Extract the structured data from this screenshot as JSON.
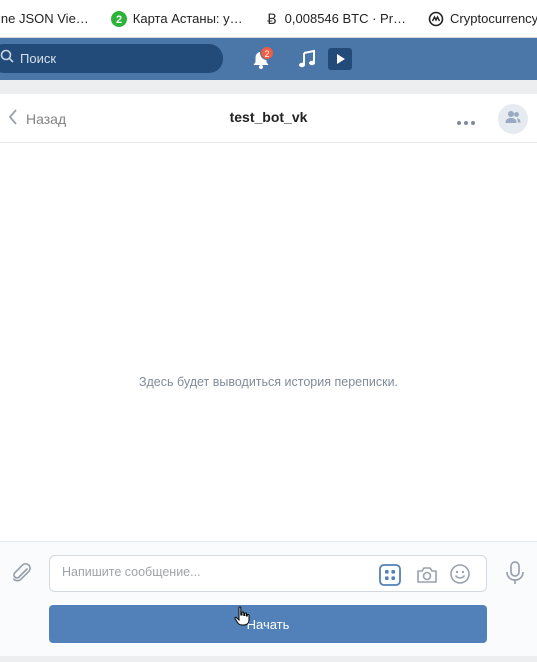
{
  "bookmarks": [
    {
      "label": "ine JSON Vie…",
      "icon": "json-viewer-icon"
    },
    {
      "label": "Карта Астаны: у…",
      "icon": "2gis-icon"
    },
    {
      "label": "0,008546 BTC · Pr…",
      "icon": "bitcoin-icon"
    },
    {
      "label": "Cryptocurrency…",
      "icon": "coinmarketcap-icon"
    }
  ],
  "topbar": {
    "search_placeholder": "Поиск",
    "notification_count": "2",
    "accent": "#4a76a8"
  },
  "chat": {
    "back_label": "Назад",
    "title": "test_bot_vk",
    "empty_text": "Здесь будет выводиться история переписки."
  },
  "composer": {
    "placeholder": "Напишите сообщение...",
    "value": "",
    "start_button": "Начать",
    "button_color": "#5181b8"
  }
}
